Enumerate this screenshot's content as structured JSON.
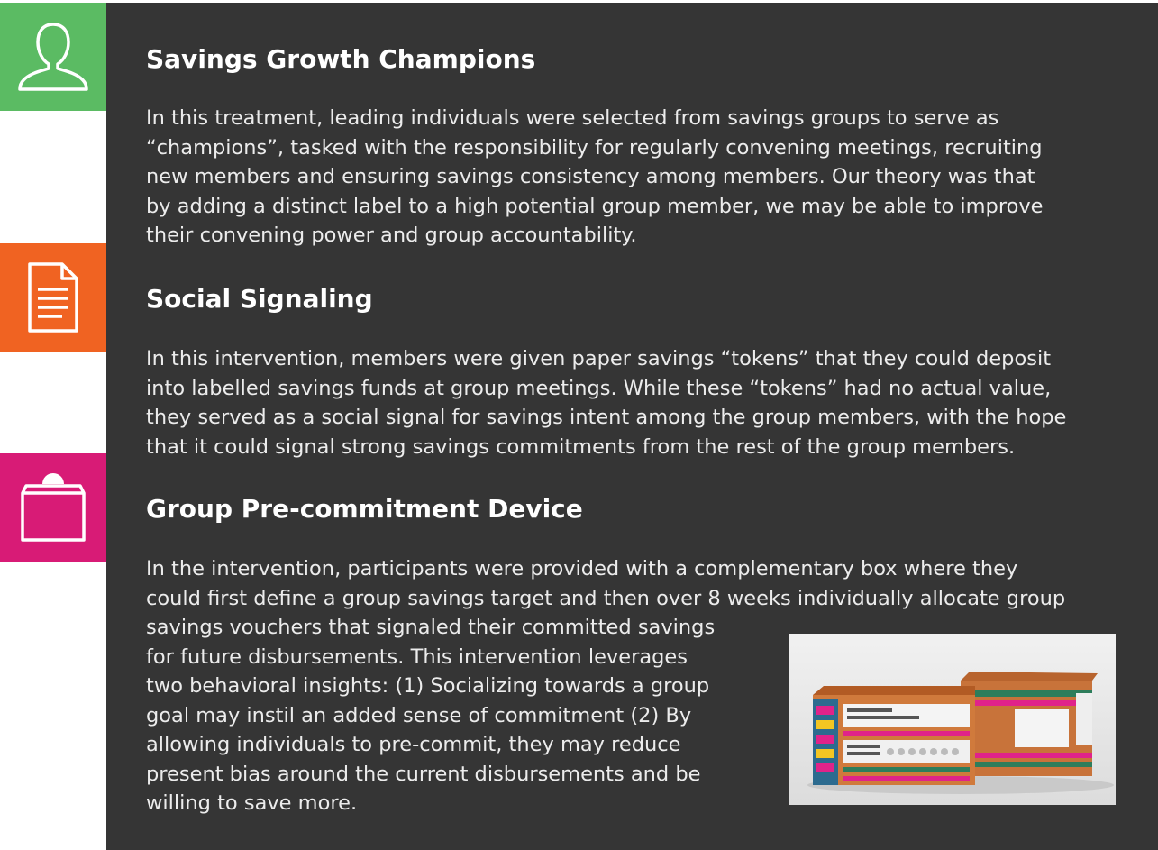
{
  "sections": [
    {
      "title": "Savings Growth Champions",
      "lines": [
        "In this treatment, leading individuals were selected from savings groups to serve as",
        "“champions”, tasked with the responsibility for regularly convening meetings, recruiting",
        "new members and ensuring savings consistency among members. Our theory was that",
        "by adding a distinct label to a high potential group member, we may be able to improve",
        "their convening power and group accountability."
      ]
    },
    {
      "title": "Social Signaling",
      "lines": [
        "In this intervention, members were given paper savings “tokens” that they could deposit",
        "into labelled savings funds at group meetings. While these “tokens” had no actual value,",
        "they served as a social signal for savings intent among the group members, with the hope",
        "that it could signal strong savings commitments from the rest of the group members."
      ]
    },
    {
      "title": "Group Pre-commitment Device",
      "lines": [
        "In the intervention, participants were provided with a complementary box where they",
        "could first define a group savings target and then over 8 weeks individually allocate group",
        "savings vouchers that signaled their committed savings",
        "for future disbursements. This intervention leverages",
        "two behavioral insights: (1) Socializing towards a group",
        "goal may instil an added sense of commitment (2) By",
        "allowing individuals to pre-commit, they may reduce",
        "present bias around the current disbursements and be",
        "willing to save more."
      ]
    }
  ],
  "icons": [
    "person-icon",
    "document-icon",
    "box-icon"
  ],
  "colors": {
    "panel": "#353535",
    "green": "#5bbb63",
    "orange": "#f06322",
    "magenta": "#d81b76"
  }
}
